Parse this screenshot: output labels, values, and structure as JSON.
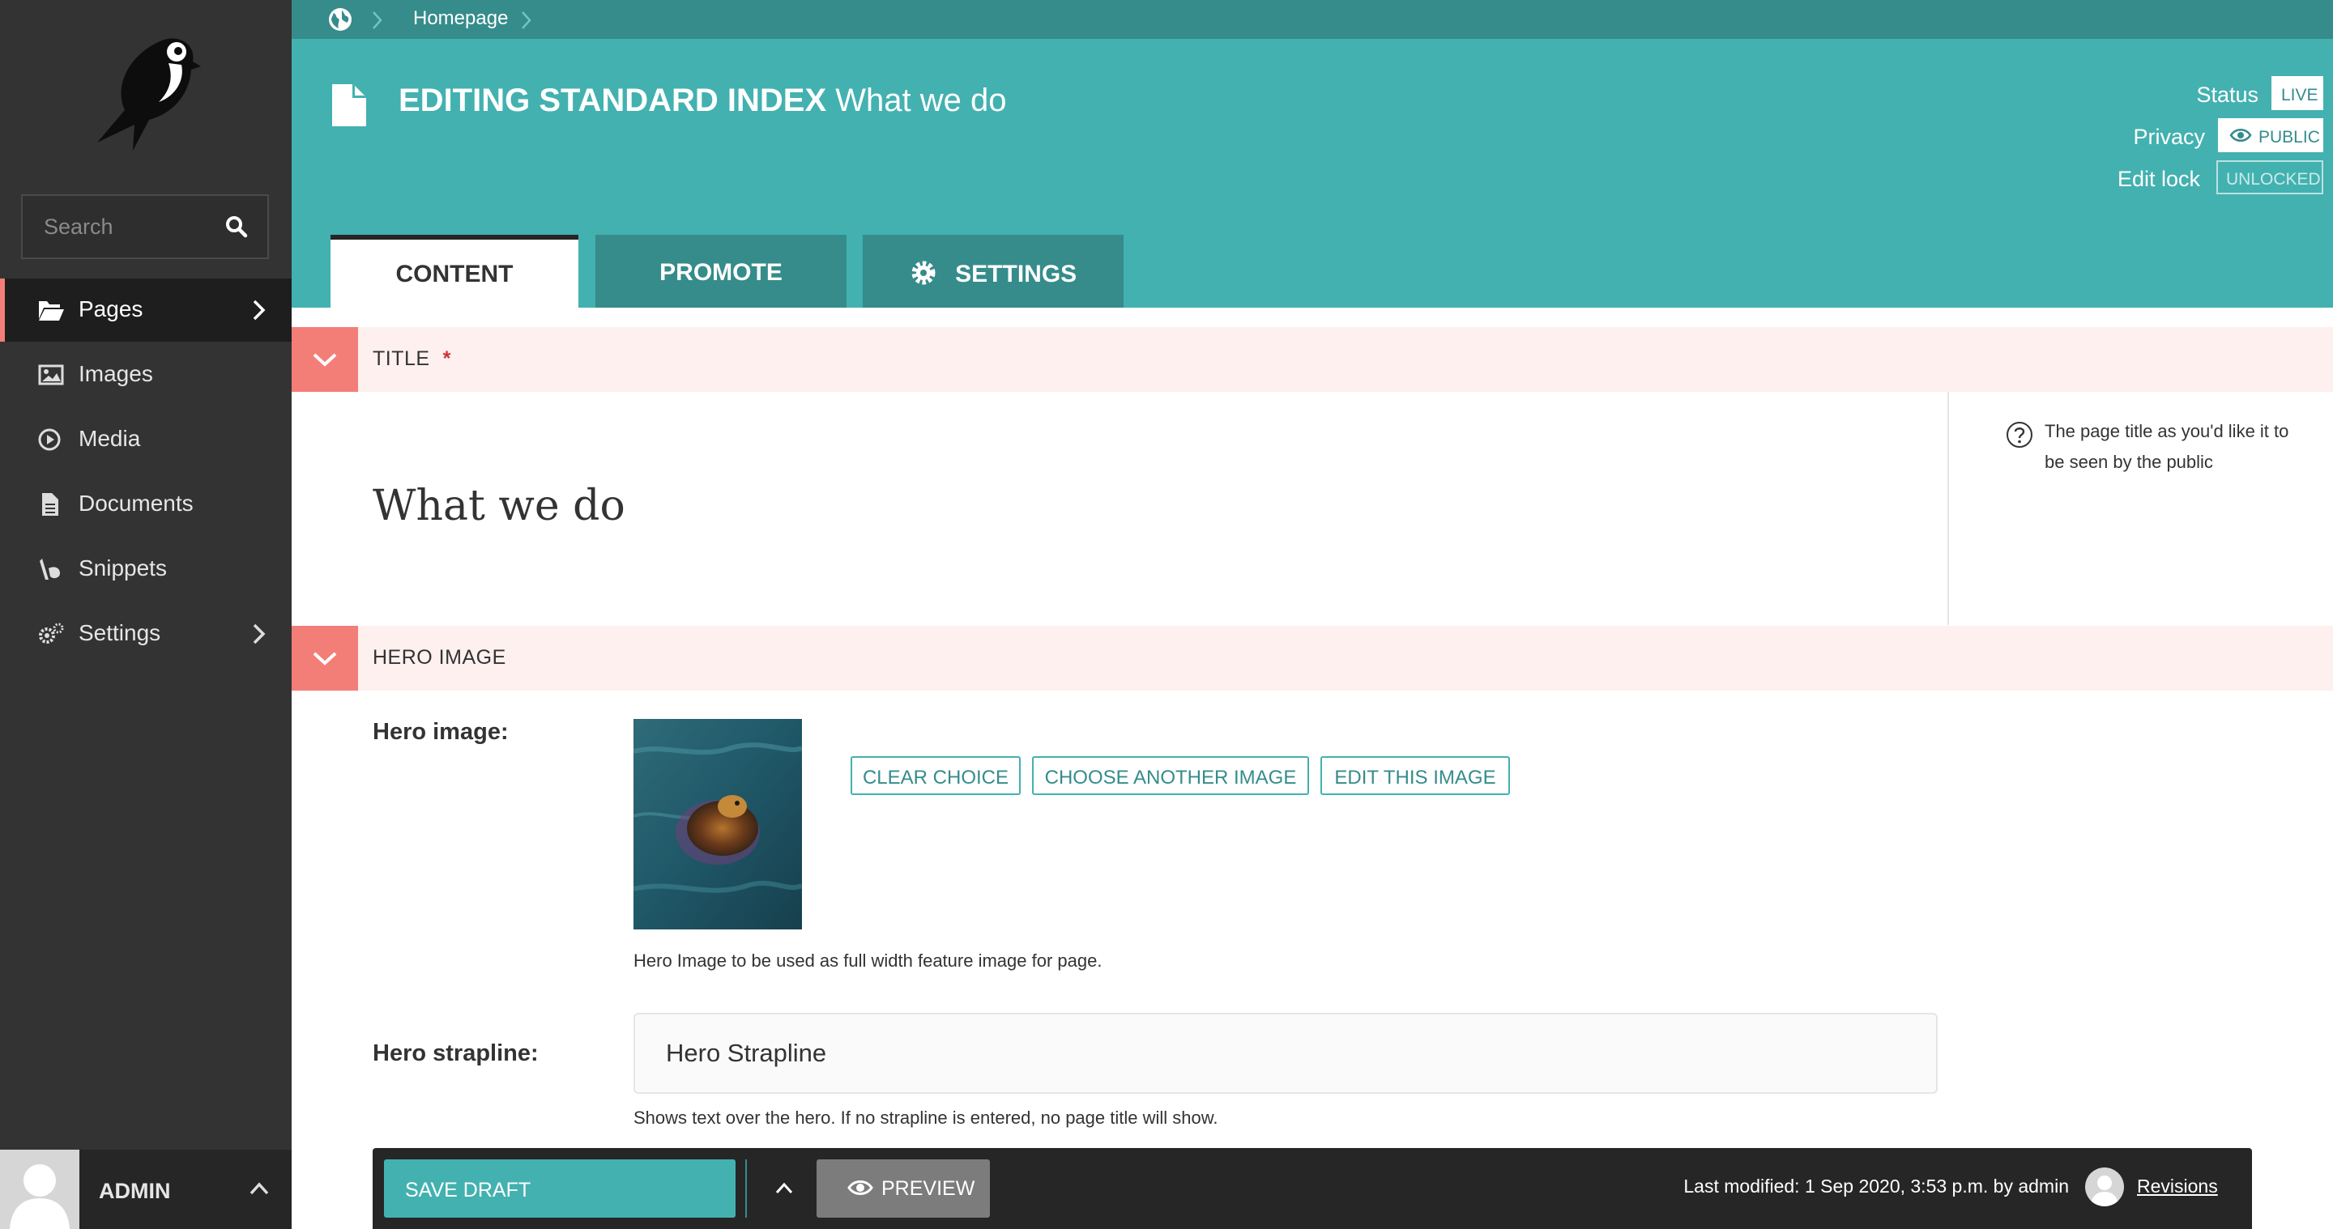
{
  "sidebar": {
    "search": {
      "placeholder": "Search"
    },
    "items": [
      {
        "label": "Pages",
        "icon": "folder-open-icon",
        "active": true,
        "has_children": true
      },
      {
        "label": "Images",
        "icon": "image-icon"
      },
      {
        "label": "Media",
        "icon": "media-play-icon"
      },
      {
        "label": "Documents",
        "icon": "document-icon"
      },
      {
        "label": "Snippets",
        "icon": "snippet-icon"
      },
      {
        "label": "Settings",
        "icon": "cogs-icon",
        "has_children": true
      }
    ],
    "account": {
      "name": "ADMIN"
    }
  },
  "header": {
    "breadcrumb": [
      "Homepage"
    ],
    "title_kind": "EDITING STANDARD INDEX",
    "title_page": "What we do",
    "meta": [
      {
        "label": "Status",
        "value": "LIVE"
      },
      {
        "label": "Privacy",
        "value": "PUBLIC"
      },
      {
        "label": "Edit lock",
        "value": "UNLOCKED"
      }
    ],
    "tabs": [
      {
        "label": "CONTENT",
        "active": true
      },
      {
        "label": "PROMOTE"
      },
      {
        "label": "SETTINGS",
        "icon": "gear-icon"
      }
    ]
  },
  "sections": {
    "title": {
      "heading": "TITLE",
      "required_marker": "*",
      "value": "What we do",
      "help": "The page title as you'd like it to be seen by the public"
    },
    "hero": {
      "heading": "HERO IMAGE",
      "image_label": "Hero image:",
      "buttons": [
        "CLEAR CHOICE",
        "CHOOSE ANOTHER IMAGE",
        "EDIT THIS IMAGE"
      ],
      "image_help": "Hero Image to be used as full width feature image for page.",
      "strapline_label": "Hero strapline:",
      "strapline_value": "Hero Strapline",
      "strapline_help": "Shows text over the hero. If no strapline is entered, no page title will show."
    }
  },
  "footer": {
    "save_label": "SAVE DRAFT",
    "preview_label": "PREVIEW",
    "last_modified": "Last modified: 1 Sep 2020, 3:53 p.m. by admin",
    "revisions_label": "Revisions"
  },
  "colors": {
    "teal": "#43b1b0",
    "teal_dark": "#358c8b",
    "sidebar": "#333333",
    "salmon": "#f37e77",
    "section_bg": "#fdf0ef"
  }
}
